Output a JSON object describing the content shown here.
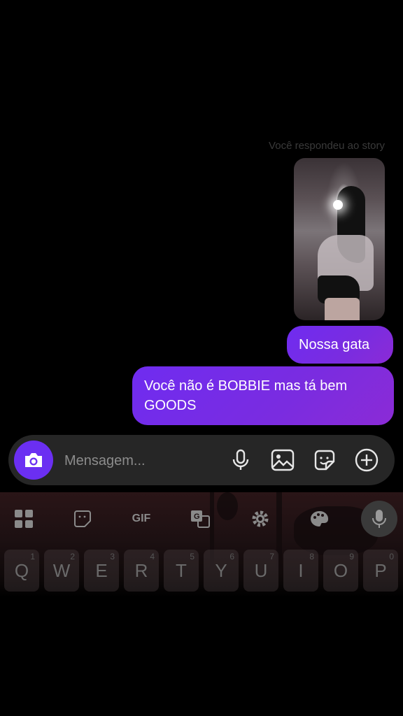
{
  "thread": {
    "story_reply_label": "Você respondeu ao story",
    "messages": [
      {
        "text": "Nossa gata",
        "sender": "me"
      },
      {
        "text": "Você não é BOBBIE mas tá bem GOODS",
        "sender": "me"
      }
    ]
  },
  "composer": {
    "placeholder": "Mensagem...",
    "icons": [
      "camera-icon",
      "microphone-icon",
      "gallery-icon",
      "sticker-icon",
      "plus-icon"
    ]
  },
  "keyboard": {
    "toolbar": [
      {
        "name": "apps-grid-icon"
      },
      {
        "name": "sticker-icon"
      },
      {
        "label": "GIF"
      },
      {
        "name": "translate-icon"
      },
      {
        "name": "settings-icon"
      },
      {
        "name": "theme-palette-icon"
      },
      {
        "name": "voice-input-icon"
      }
    ],
    "row1": [
      {
        "key": "Q",
        "hint": "1"
      },
      {
        "key": "W",
        "hint": "2"
      },
      {
        "key": "E",
        "hint": "3"
      },
      {
        "key": "R",
        "hint": "4"
      },
      {
        "key": "T",
        "hint": "5"
      },
      {
        "key": "Y",
        "hint": "6"
      },
      {
        "key": "U",
        "hint": "7"
      },
      {
        "key": "I",
        "hint": "8"
      },
      {
        "key": "O",
        "hint": "9"
      },
      {
        "key": "P",
        "hint": "0"
      }
    ]
  },
  "colors": {
    "bubble": "#7a2ce0",
    "accent": "#6b2ff2",
    "background": "#000000"
  }
}
